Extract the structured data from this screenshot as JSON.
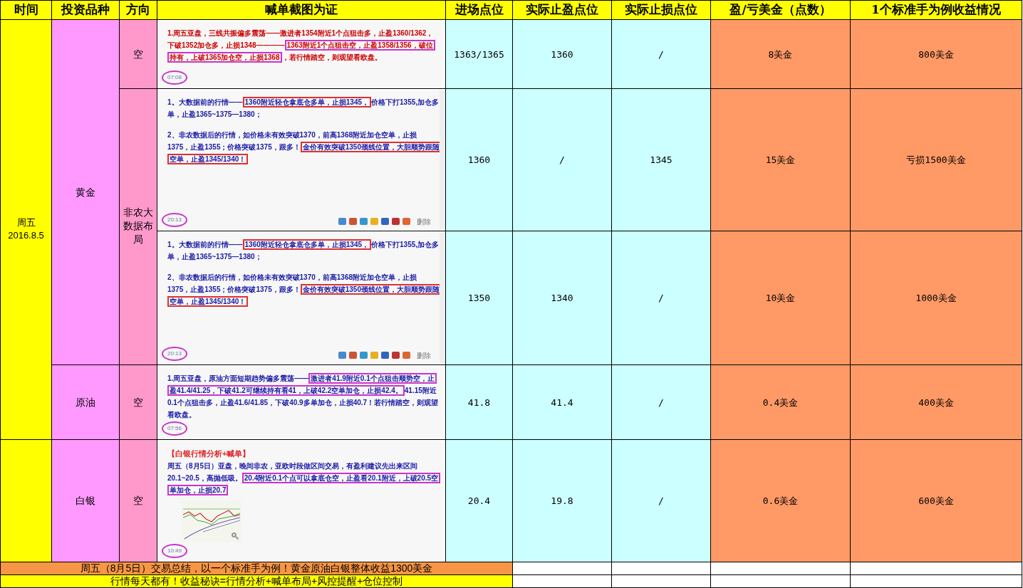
{
  "headers": [
    "时间",
    "投资品种",
    "方向",
    "喊单截图为证",
    "进场点位",
    "实际止盈点位",
    "实际止损点位",
    "盈/亏美金（点数）",
    "1个标准手为例收益情况"
  ],
  "periods": [
    {
      "time_lines": [
        "周五",
        "2016.8.5"
      ],
      "assets": [
        {
          "name": "黄金",
          "directions": [
            {
              "label": "空",
              "trades": [
                {
                  "post": {
                    "color": "#cc0000",
                    "paragraphs": [
                      [
                        {
                          "text": "1.周五亚盘，三线共振偏多震荡——激进者1354附近1个点狙击多，止盈1360/1362，下破1352加仓多，止损1348————",
                          "boxed": false
                        },
                        {
                          "text": "1363附近1个点狙击空，止盈1358/1356，破位持有，上破1365加仓空，止损1368",
                          "boxed": true,
                          "color": "#cc33cc"
                        },
                        {
                          "text": "，若行情踏空，则观望看欧盘。",
                          "boxed": false
                        }
                      ]
                    ],
                    "time": "07:08"
                  },
                  "entry": "1363/1365",
                  "take_profit": "1360",
                  "stop_loss": "/",
                  "pnl": "8美金",
                  "result": "800美金"
                }
              ]
            },
            {
              "label": "非农大数据布局",
              "trades": [
                {
                  "post": {
                    "color": "#1a1aa6",
                    "paragraphs": [
                      [
                        {
                          "text": "1。大数据前的行情——",
                          "boxed": false
                        },
                        {
                          "text": "1360附近轻仓拿底仓多单，止损1345，",
                          "boxed": true,
                          "color": "#e03030"
                        },
                        {
                          "text": "价格下打1355,加仓多单，止盈1365~1375—1380；",
                          "boxed": false
                        }
                      ],
                      [
                        {
                          "text": "2、非农数据后的行情，如价格未有效突破1370，前高1368附近加仓空单，止损1375，止盈1355；价格突破1375，跟多！",
                          "boxed": false
                        },
                        {
                          "text": "金价有效突破1350颈线位置，大胆顺势跟随空单，止盈1345/1340！",
                          "boxed": true,
                          "color": "#e03030"
                        }
                      ]
                    ],
                    "time": "20:13",
                    "toolbar_label": "删除"
                  },
                  "entry": "1360",
                  "take_profit": "/",
                  "stop_loss": "1345",
                  "pnl": "15美金",
                  "result": "亏损1500美金"
                },
                {
                  "post": {
                    "color": "#1a1aa6",
                    "paragraphs": [
                      [
                        {
                          "text": "1。大数据前的行情——",
                          "boxed": false
                        },
                        {
                          "text": "1360附近轻仓拿底仓多单，止损1345，",
                          "boxed": true,
                          "color": "#e03030"
                        },
                        {
                          "text": "价格下打1355,加仓多单，止盈1365~1375—1380；",
                          "boxed": false
                        }
                      ],
                      [
                        {
                          "text": "2、非农数据后的行情，如价格未有效突破1370，前高1368附近加仓空单，止损1375，止盈1355；价格突破1375，跟多！",
                          "boxed": false
                        },
                        {
                          "text": "金价有效突破1350颈线位置，大胆顺势跟随空单，止盈1345/1340！",
                          "boxed": true,
                          "color": "#e03030"
                        }
                      ]
                    ],
                    "time": "20:13",
                    "toolbar_label": "删除"
                  },
                  "entry": "1350",
                  "take_profit": "1340",
                  "stop_loss": "/",
                  "pnl": "10美金",
                  "result": "1000美金"
                }
              ]
            }
          ]
        },
        {
          "name": "原油",
          "directions": [
            {
              "label": "空",
              "trades": [
                {
                  "post": {
                    "color": "#1a1aa6",
                    "paragraphs": [
                      [
                        {
                          "text": "1.周五亚盘，原油方面短期趋势偏多震荡——",
                          "boxed": false
                        },
                        {
                          "text": "激进者41.9附近0.1个点狙击顺势空，止盈41.4/41.25，下破41.2可继续持有看41，上破42.2空单加仓，止损42.4。",
                          "boxed": true,
                          "color": "#cc33cc"
                        },
                        {
                          "text": "41.15附近0.1个点狙击多，止盈41.6/41.85，下破40.9多单加仓，止损40.7！若行情踏空，则观望看欧盘。",
                          "boxed": false
                        }
                      ]
                    ],
                    "time": "07:56"
                  },
                  "entry": "41.8",
                  "take_profit": "41.4",
                  "stop_loss": "/",
                  "pnl": "0.4美金",
                  "result": "400美金"
                }
              ]
            }
          ]
        }
      ]
    },
    {
      "assets": [
        {
          "name": "白银",
          "directions": [
            {
              "label": "空",
              "trades": [
                {
                  "post": {
                    "color": "#1a1aa6",
                    "title": "【白银行情分析+喊单】",
                    "paragraphs": [
                      [
                        {
                          "text": "周五（8月5日）亚盘，晚间非农，亚欧时段做区间交易，有盈利建议先出来区间20.1~20.5，高抛低吸。",
                          "boxed": false
                        },
                        {
                          "text": "20.4附近0.1个点可以拿底仓空，止盈看20.1附近，上破20.5空单加仓，止损20.7",
                          "boxed": true,
                          "color": "#cc33cc"
                        }
                      ]
                    ],
                    "thumbnail": {
                      "kind": "chart"
                    },
                    "time": "10:49"
                  },
                  "entry": "20.4",
                  "take_profit": "19.8",
                  "stop_loss": "/",
                  "pnl": "0.6美金",
                  "result": "600美金"
                }
              ]
            }
          ]
        }
      ]
    }
  ],
  "summary": "周五（8月5日）交易总结，以一个标准手为例！黄金原油白银整体收益1300美金",
  "slogan": "行情每天都有！收益秘诀=行情分析+喊单布局+风控提醒+仓位控制"
}
